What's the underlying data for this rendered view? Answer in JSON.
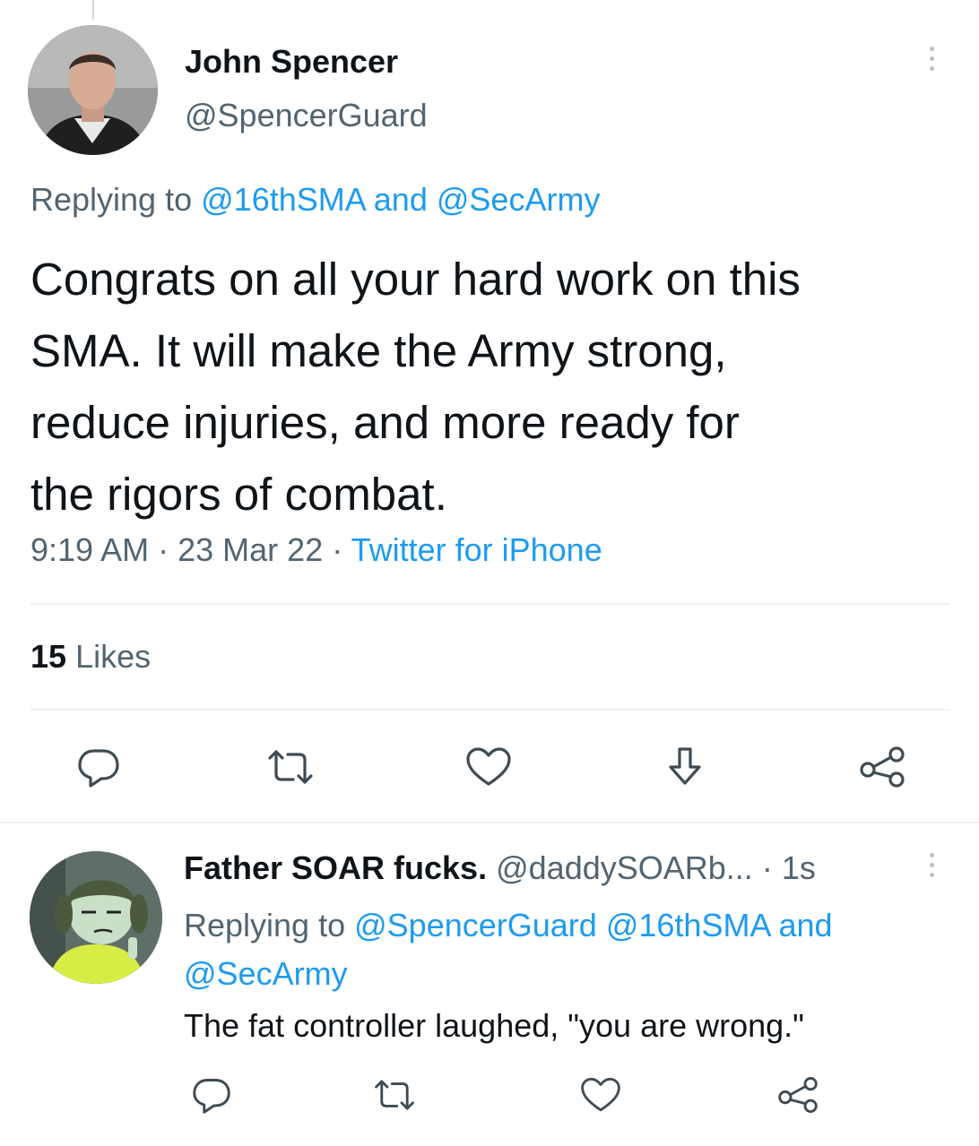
{
  "main_tweet": {
    "author_name": "John Spencer",
    "author_handle": "@SpencerGuard",
    "replying_prefix": "Replying to",
    "replying_mention_1": "@16thSMA",
    "replying_and": "and",
    "replying_mention_2": "@SecArmy",
    "text_lines": [
      "Congrats on all your hard work on this",
      "SMA. It will make the Army strong,",
      "reduce injuries, and more ready for",
      "the rigors of combat."
    ],
    "time": "9:19 AM",
    "separator": "·",
    "date": "23 Mar 22",
    "source": "Twitter for iPhone",
    "likes_count": "15",
    "likes_label": "Likes",
    "actions": [
      "reply-icon",
      "retweet-icon",
      "like-icon",
      "bookmark-down-icon",
      "share-icon"
    ]
  },
  "reply_tweet": {
    "author_name": "Father SOAR fucks.",
    "author_handle": "@daddySOARb...",
    "separator": "·",
    "time_ago": "1s",
    "replying_prefix": "Replying to",
    "replying_mention_1": "@SpencerGuard",
    "replying_mention_2": "@16thSMA",
    "replying_and": "and",
    "replying_mention_3": "@SecArmy",
    "text": "The fat controller laughed, \"you are wrong.\"",
    "actions": [
      "reply-icon",
      "retweet-icon",
      "like-icon",
      "share-icon"
    ]
  },
  "colors": {
    "text": "#0f1419",
    "secondary": "#536471",
    "accent": "#1d9bf0",
    "divider": "#eff3f4",
    "icon": "#404a52"
  }
}
